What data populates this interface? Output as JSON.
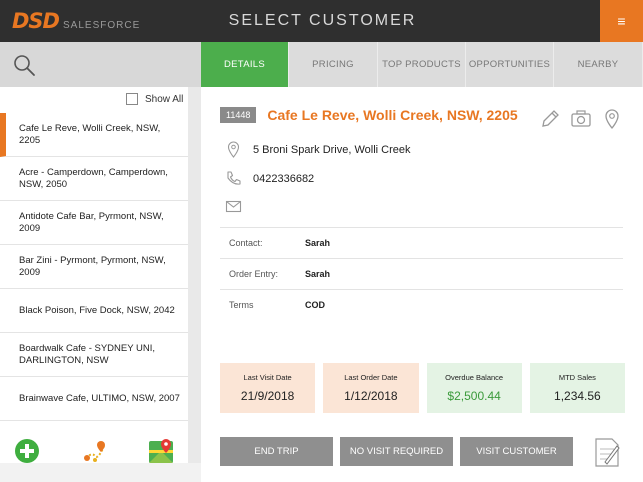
{
  "header": {
    "logo_main": "DSD",
    "logo_sub": "SALESFORCE",
    "title": "SELECT CUSTOMER",
    "menu_glyph": "≡"
  },
  "icons": {
    "search": "search-icon",
    "menu": "hamburger-menu-icon",
    "add": "add-plus-icon",
    "route": "route-map-icon",
    "maps": "google-maps-icon",
    "edit": "pencil-icon",
    "camera": "camera-icon",
    "location": "location-pin-icon",
    "phone": "phone-icon",
    "email": "mail-icon",
    "note": "note-icon"
  },
  "colors": {
    "brand_orange": "#e87722",
    "active_tab_green": "#4cae4c",
    "header_dark": "#2f2f2f",
    "button_grey": "#8f8f8f"
  },
  "sidebar": {
    "show_all_label": "Show All",
    "show_all_checked": false,
    "customers": [
      {
        "label": "Cafe Le Reve, Wolli Creek, NSW, 2205",
        "active": true
      },
      {
        "label": "Acre - Camperdown, Camperdown, NSW, 2050",
        "active": false
      },
      {
        "label": "Antidote Cafe Bar, Pyrmont, NSW, 2009",
        "active": false
      },
      {
        "label": "Bar Zini - Pyrmont, Pyrmont, NSW, 2009",
        "active": false
      },
      {
        "label": "Black Poison, Five Dock, NSW, 2042",
        "active": false
      },
      {
        "label": "Boardwalk Cafe - SYDNEY UNI, DARLINGTON, NSW",
        "active": false
      },
      {
        "label": "Brainwave Cafe, ULTIMO, NSW, 2007",
        "active": false
      }
    ]
  },
  "tabs": [
    {
      "label": "DETAILS",
      "active": true
    },
    {
      "label": "PRICING",
      "active": false
    },
    {
      "label": "TOP PRODUCTS",
      "active": false
    },
    {
      "label": "OPPORTUNITIES",
      "active": false
    },
    {
      "label": "NEARBY",
      "active": false
    }
  ],
  "customer": {
    "id": "11448",
    "name": "Cafe Le Reve, Wolli Creek, NSW, 2205",
    "address": "5 Broni Spark Drive, Wolli Creek",
    "phone": "0422336682",
    "email": "",
    "fields": [
      {
        "key": "Contact:",
        "value": "Sarah"
      },
      {
        "key": "Order Entry:",
        "value": "Sarah"
      },
      {
        "key": "Terms",
        "value": "COD"
      }
    ]
  },
  "stats": [
    {
      "label": "Last Visit Date",
      "value": "21/9/2018",
      "style": "peach"
    },
    {
      "label": "Last Order Date",
      "value": "1/12/2018",
      "style": "peach"
    },
    {
      "label": "Overdue Balance",
      "value": "$2,500.44",
      "style": "green"
    },
    {
      "label": "MTD Sales",
      "value": "1,234.56",
      "style": "green"
    }
  ],
  "actions": {
    "end_trip": "END TRIP",
    "no_visit": "NO VISIT REQUIRED",
    "visit": "VISIT CUSTOMER"
  }
}
